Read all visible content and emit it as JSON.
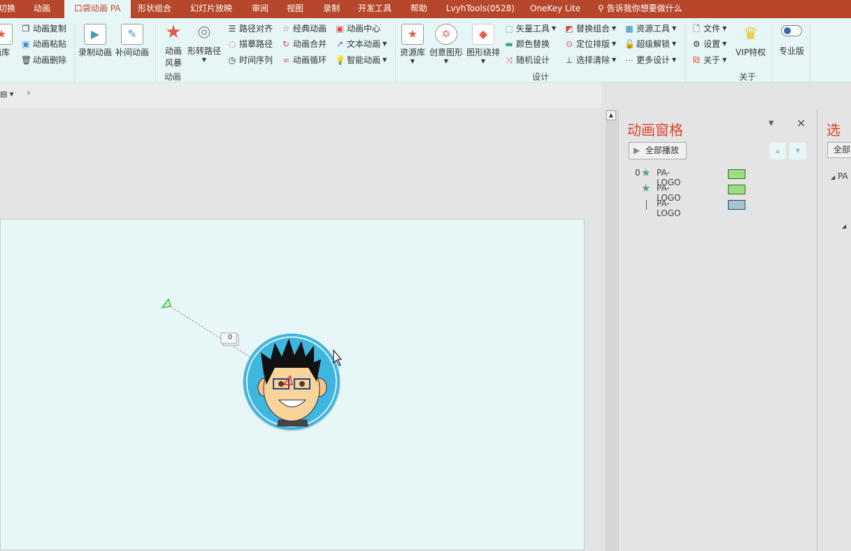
{
  "tabs": [
    "切换",
    "动画",
    "口袋动画 PA",
    "形状组合",
    "幻灯片放映",
    "审阅",
    "视图",
    "录制",
    "开发工具",
    "帮助",
    "LvyhTools(0528)",
    "OneKey Lite"
  ],
  "tell_me": "告诉我你想要做什么",
  "ribbon": {
    "lib": "画库",
    "copy": "动画复制",
    "paste": "动画粘贴",
    "delete": "动画删除",
    "record": "录制动画",
    "tween": "补间动画",
    "storm1": "动画",
    "storm2": "风暴",
    "morph": "形转路径",
    "align_path": "路径对齐",
    "trace_path": "描摹路径",
    "time_seq": "时间序列",
    "classic": "经典动画",
    "merge": "动画合并",
    "loop": "动画循环",
    "center": "动画中心",
    "text_anim": "文本动画",
    "smart_anim": "智能动画",
    "group_anim": "动画",
    "resource": "资源库",
    "creative": "创意图形",
    "wrap": "图形绕排",
    "vector": "矢量工具",
    "recolor": "颜色替换",
    "random": "随机设计",
    "replace_group": "替换组合",
    "position": "定位排版",
    "clear_sel": "选择清除",
    "res_tools": "资源工具",
    "unlock": "超级解锁",
    "more_design": "更多设计",
    "group_design": "设计",
    "file": "文件",
    "settings": "设置",
    "about": "关于",
    "vip": "VIP特权",
    "pro": "专业版",
    "group_about": "关于"
  },
  "anim_pane": {
    "title": "动画窗格",
    "play_all": "全部播放",
    "items": [
      {
        "index": "0",
        "name": "PA-LOGO",
        "color": "#9ddc82"
      },
      {
        "index": "",
        "name": "PA-LOGO",
        "color": "#9ddc82"
      },
      {
        "index": "",
        "name": "PA-LOGO",
        "color": "#a4c4d4"
      }
    ]
  },
  "select_pane": {
    "title": "选择",
    "show_all": "全部",
    "item": "PA"
  },
  "slide": {
    "tag": "0"
  },
  "colors": {
    "accent": "#b7472a",
    "pane_title": "#d8442a",
    "ribbon_bg": "#e6f6f6"
  }
}
